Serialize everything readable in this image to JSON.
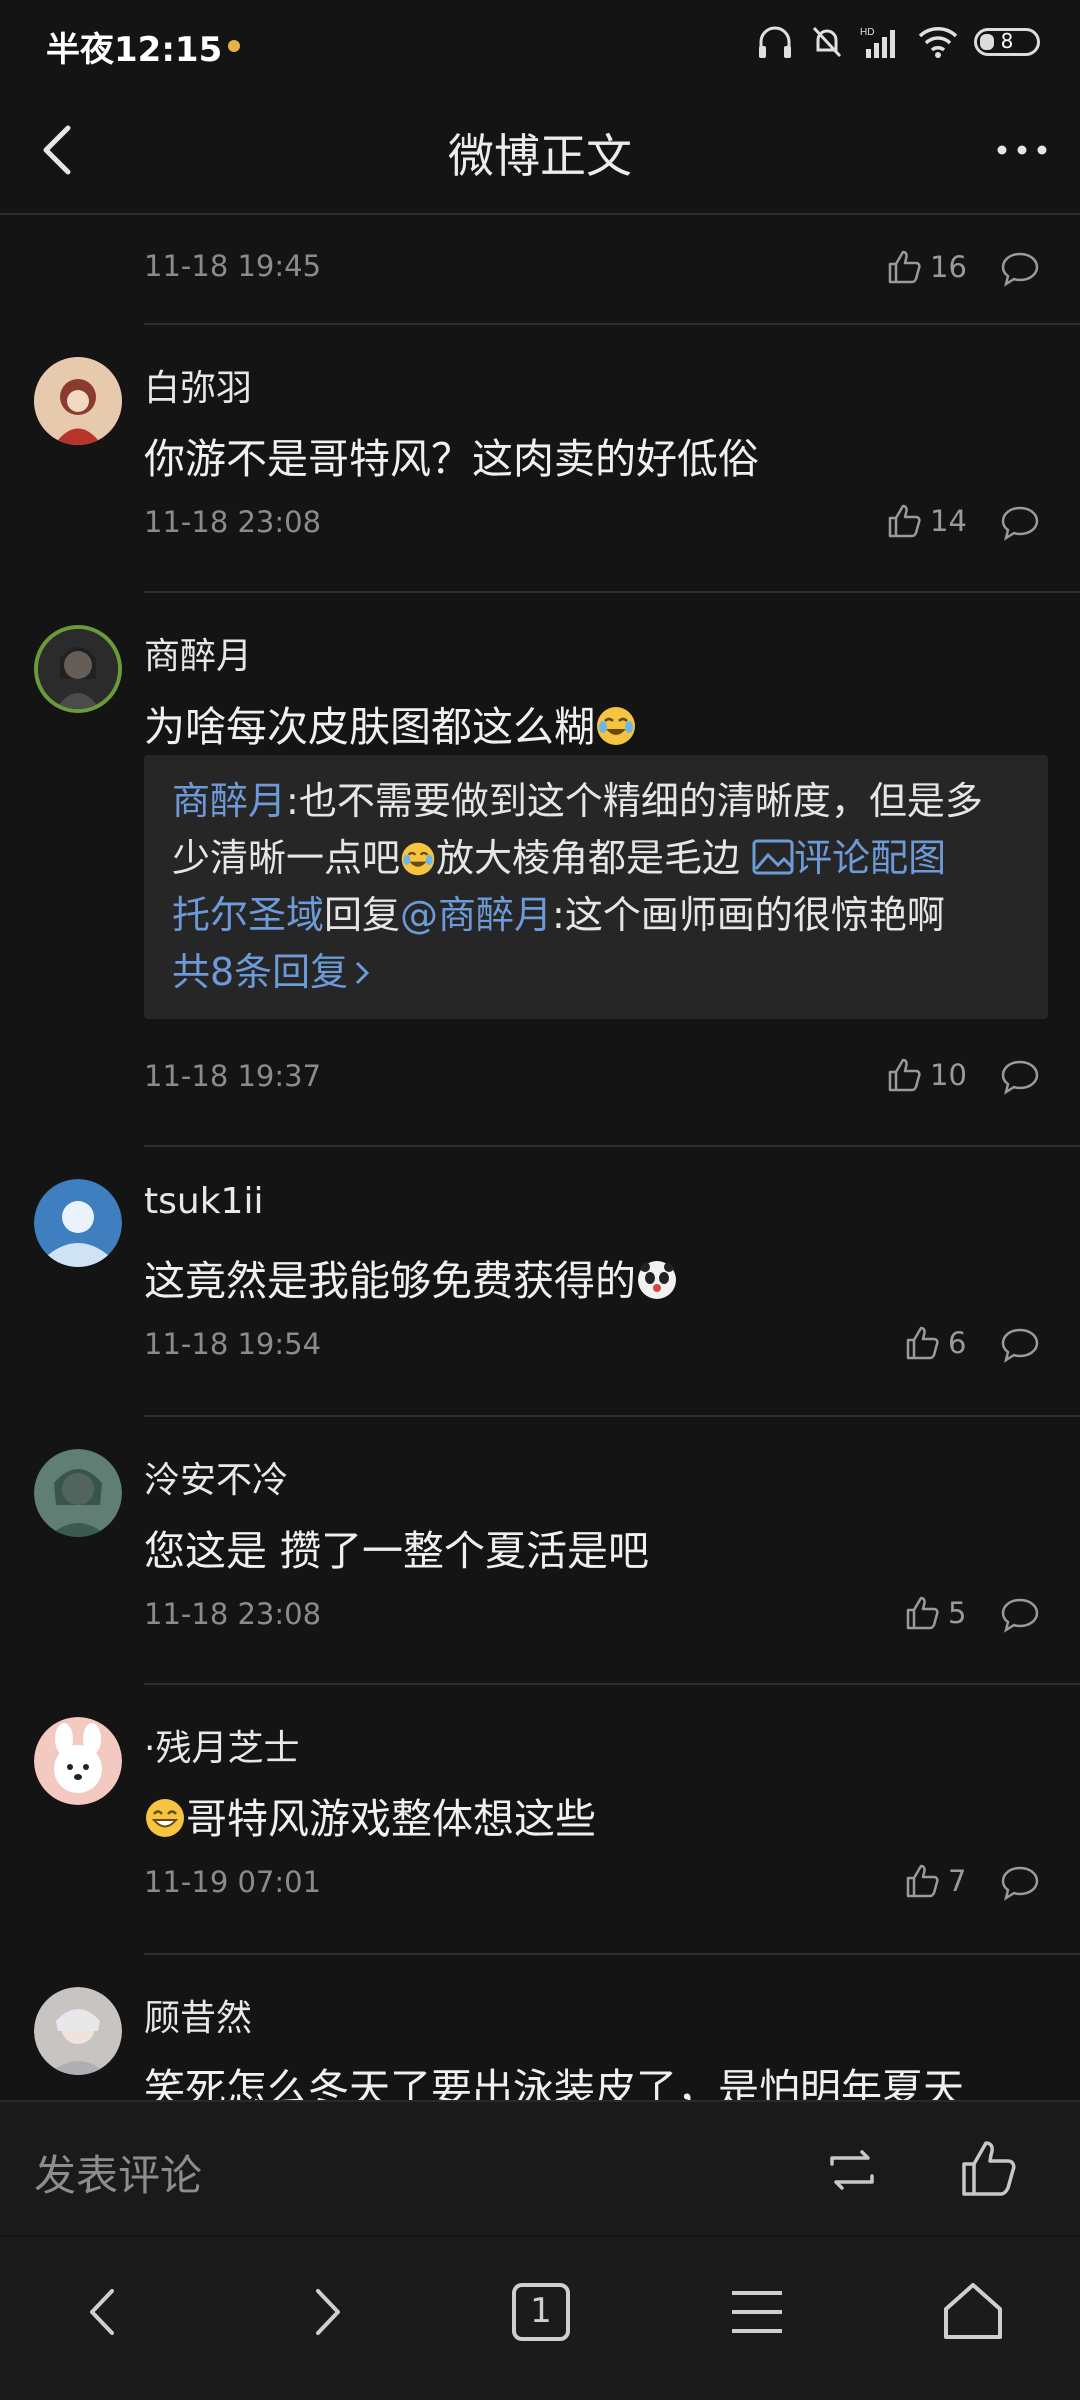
{
  "status_bar": {
    "time": "半夜12:15",
    "battery": "8"
  },
  "header": {
    "title": "微博正文"
  },
  "comments": [
    {
      "time": "11-18 19:45",
      "likes": "16"
    },
    {
      "username": "白弥羽",
      "text": "你游不是哥特风？这肉卖的好低俗",
      "time": "11-18 23:08",
      "likes": "14"
    },
    {
      "username": "商醉月",
      "text": "为啥每次皮肤图都这么糊",
      "time": "11-18 19:37",
      "likes": "10",
      "replies": {
        "r1_name": "商醉月",
        "r1_text_a": ":也不需要做到这个精细的清晰度，但是多少清晰一点吧",
        "r1_text_b": "放大棱角都是毛边 ",
        "r1_link": "评论配图",
        "r2_name": "托尔圣域",
        "r2_mid": "回复",
        "r2_at": "@商醉月",
        "r2_text": ":这个画师画的很惊艳啊",
        "more": "共8条回复"
      }
    },
    {
      "username": "tsuk1ii",
      "text": "这竟然是我能够免费获得的",
      "time": "11-18 19:54",
      "likes": "6"
    },
    {
      "username": "泠安不冷",
      "text": "您这是 攒了一整个夏活是吧",
      "time": "11-18 23:08",
      "likes": "5"
    },
    {
      "username": "·残月芝士",
      "text": "哥特风游戏整体想这些",
      "time": "11-19 07:01",
      "likes": "7"
    },
    {
      "username": "顾昔然",
      "text": "笑死怎么冬天了要出泳装皮了，是怕明年夏天"
    }
  ],
  "comment_bar": {
    "placeholder": "发表评论"
  },
  "nav": {
    "tabs_count": "1"
  },
  "colors": {
    "background": "#141414",
    "link": "#6d9ad8",
    "muted": "#8b8b8b"
  }
}
